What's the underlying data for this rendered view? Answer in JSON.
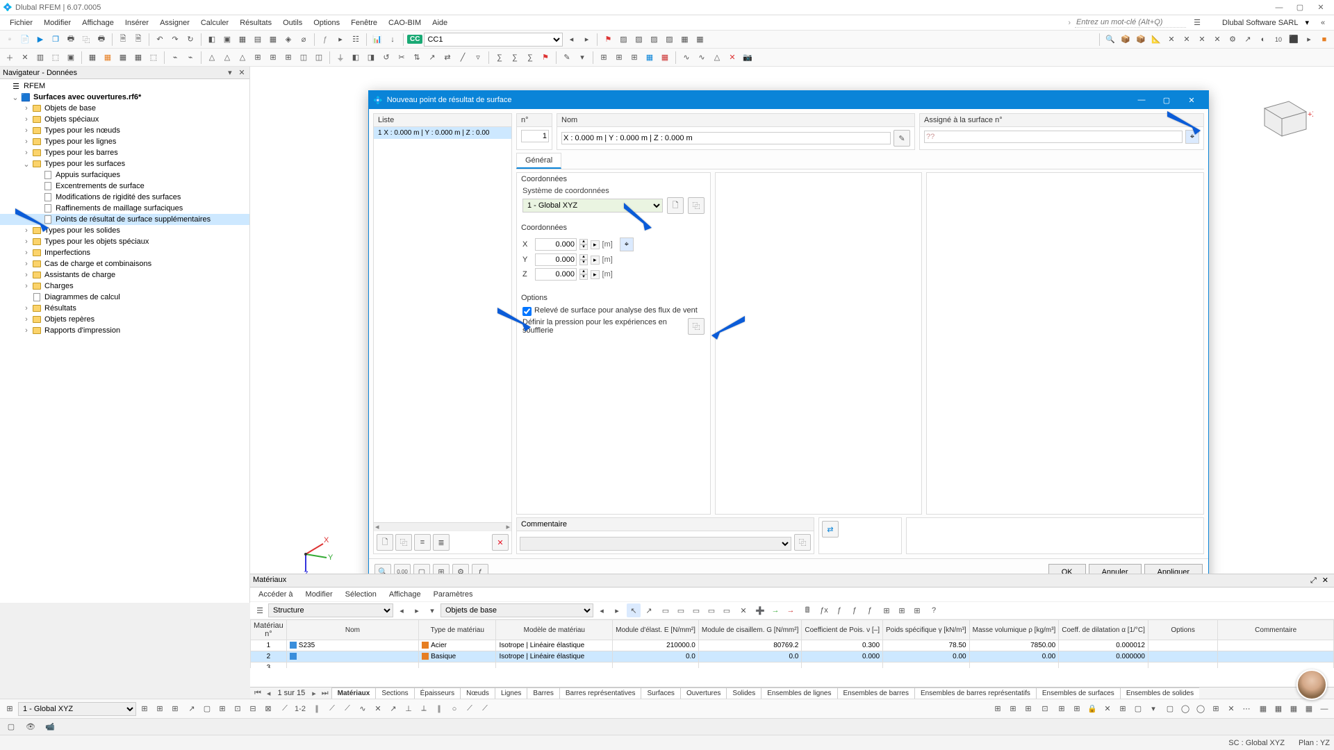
{
  "app": {
    "title": "Dlubal RFEM | 6.07.0005",
    "company": "Dlubal Software SARL",
    "keyword_placeholder": "Entrez un mot-clé (Alt+Q)"
  },
  "menu": [
    "Fichier",
    "Modifier",
    "Affichage",
    "Insérer",
    "Assigner",
    "Calculer",
    "Résultats",
    "Outils",
    "Options",
    "Fenêtre",
    "CAO-BIM",
    "Aide"
  ],
  "cc_badge": "CC",
  "cc_selected": "CC1",
  "navigator": {
    "title": "Navigateur - Données",
    "root": "RFEM",
    "project": "Surfaces avec ouvertures.rf6*",
    "items": [
      {
        "label": "Objets de base",
        "exp": "›",
        "indent": 2
      },
      {
        "label": "Objets spéciaux",
        "exp": "›",
        "indent": 2
      },
      {
        "label": "Types pour les nœuds",
        "exp": "›",
        "indent": 2
      },
      {
        "label": "Types pour les lignes",
        "exp": "›",
        "indent": 2
      },
      {
        "label": "Types pour les barres",
        "exp": "›",
        "indent": 2
      },
      {
        "label": "Types pour les surfaces",
        "exp": "⌄",
        "indent": 2
      },
      {
        "label": "Appuis surfaciques",
        "icon": "file",
        "indent": 3
      },
      {
        "label": "Excentrements de surface",
        "icon": "file",
        "indent": 3
      },
      {
        "label": "Modifications de rigidité des surfaces",
        "icon": "file",
        "indent": 3
      },
      {
        "label": "Raffinements de maillage surfaciques",
        "icon": "file",
        "indent": 3
      },
      {
        "label": "Points de résultat de surface supplémentaires",
        "icon": "file",
        "indent": 3,
        "selected": true
      },
      {
        "label": "Types pour les solides",
        "exp": "›",
        "indent": 2
      },
      {
        "label": "Types pour les objets spéciaux",
        "exp": "›",
        "indent": 2
      },
      {
        "label": "Imperfections",
        "exp": "›",
        "indent": 2
      },
      {
        "label": "Cas de charge et combinaisons",
        "exp": "›",
        "indent": 2
      },
      {
        "label": "Assistants de charge",
        "exp": "›",
        "indent": 2
      },
      {
        "label": "Charges",
        "exp": "›",
        "indent": 2
      },
      {
        "label": "Diagrammes de calcul",
        "icon": "file",
        "indent": 2
      },
      {
        "label": "Résultats",
        "exp": "›",
        "indent": 2
      },
      {
        "label": "Objets repères",
        "exp": "›",
        "indent": 2
      },
      {
        "label": "Rapports d'impression",
        "exp": "›",
        "indent": 2
      }
    ]
  },
  "dialog": {
    "title": "Nouveau point de résultat de surface",
    "list_head": "Liste",
    "list_row": "1   X : 0.000 m | Y : 0.000 m | Z : 0.00",
    "n_head": "n°",
    "n_value": "1",
    "nom_head": "Nom",
    "nom_value": "X : 0.000 m | Y : 0.000 m | Z : 0.000 m",
    "assign_head": "Assigné à la surface n°",
    "assign_value": "??",
    "tab_general": "Général",
    "coords_title": "Coordonnées",
    "coord_sys_label": "Système de coordonnées",
    "coord_sys_value": "1 - Global XYZ",
    "coords_sub": "Coordonnées",
    "x_val": "0.000",
    "y_val": "0.000",
    "z_val": "0.000",
    "unit": "[m]",
    "options_title": "Options",
    "opt_check_label": "Relevé de surface pour analyse des flux de vent",
    "pressure_label": "Définir la pression pour les expériences en soufflerie",
    "comment_title": "Commentaire",
    "ok": "OK",
    "cancel": "Annuler",
    "apply": "Appliquer"
  },
  "materials": {
    "title": "Matériaux",
    "menu": [
      "Accéder à",
      "Modifier",
      "Sélection",
      "Affichage",
      "Paramètres"
    ],
    "structure_label": "Structure",
    "objects_label": "Objets de base",
    "cols_group_left": "Matériau",
    "cols": [
      "n°",
      "Nom",
      "Type de matériau",
      "Modèle de matériau",
      "Module d'élast. E [N/mm²]",
      "Module de cisaillem. G [N/mm²]",
      "Coefficient de Pois. ν [–]",
      "Poids spécifique γ [kN/m³]",
      "Masse volumique ρ [kg/m³]",
      "Coeff. de dilatation α [1/°C]",
      "Options",
      "Commentaire"
    ],
    "rows": [
      {
        "n": "1",
        "nom": "S235",
        "type": "Acier",
        "modele": "Isotrope | Linéaire élastique",
        "E": "210000.0",
        "G": "80769.2",
        "v": "0.300",
        "gamma": "78.50",
        "rho": "7850.00",
        "alpha": "0.000012",
        "sw": "blue"
      },
      {
        "n": "2",
        "nom": "",
        "type": "Basique",
        "modele": "Isotrope | Linéaire élastique",
        "E": "0.0",
        "G": "0.0",
        "v": "0.000",
        "gamma": "0.00",
        "rho": "0.00",
        "alpha": "0.000000",
        "sw": "blue",
        "selected": true
      },
      {
        "n": "3",
        "nom": "",
        "type": "",
        "modele": "",
        "E": "",
        "G": "",
        "v": "",
        "gamma": "",
        "rho": "",
        "alpha": ""
      }
    ],
    "page": "1 sur 15",
    "tabs": [
      "Matériaux",
      "Sections",
      "Épaisseurs",
      "Nœuds",
      "Lignes",
      "Barres",
      "Barres représentatives",
      "Surfaces",
      "Ouvertures",
      "Solides",
      "Ensembles de lignes",
      "Ensembles de barres",
      "Ensembles de barres représentatifs",
      "Ensembles de surfaces",
      "Ensembles de solides"
    ]
  },
  "status": {
    "cs": "1 - Global XYZ",
    "sc": "SC : Global XYZ",
    "plan": "Plan : YZ"
  }
}
